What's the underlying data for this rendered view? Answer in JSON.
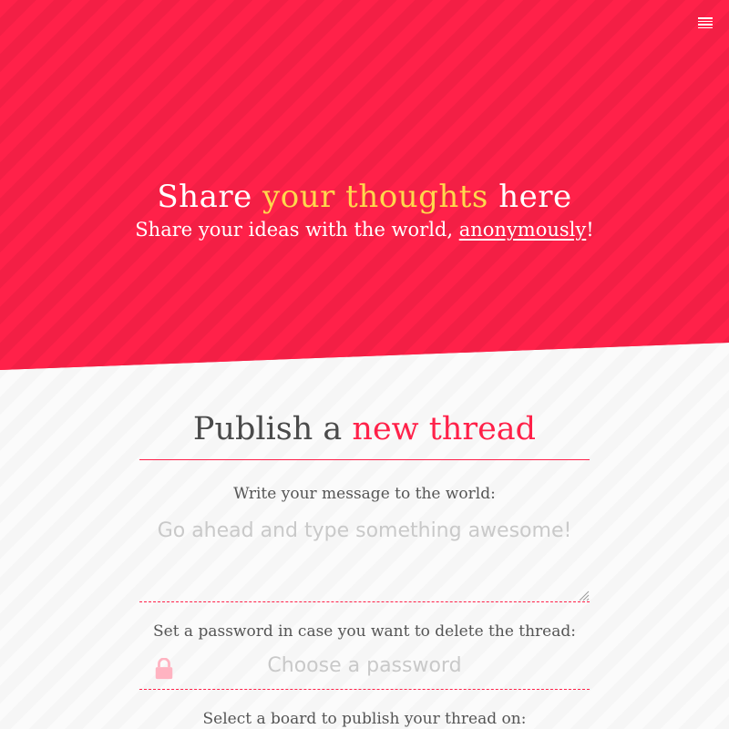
{
  "hero": {
    "title_part1": "Share ",
    "title_accent": "your thoughts",
    "title_part2": " here",
    "subtitle_part1": "Share your ideas with the world, ",
    "subtitle_link": "anonymously",
    "subtitle_part2": "!"
  },
  "menu": {
    "icon": "hamburger-menu-icon"
  },
  "form": {
    "title_part1": "Publish a ",
    "title_accent": "new thread",
    "message_label": "Write your message to the world:",
    "message_placeholder": "Go ahead and type something awesome!",
    "password_label": "Set a password in case you want to delete the thread:",
    "password_placeholder": "Choose a password",
    "board_label": "Select a board to publish your thread on:"
  },
  "colors": {
    "accent": "#ff2149",
    "highlight": "#ffd84d",
    "text_dark": "#4a4a4a",
    "placeholder": "#c9c9c9",
    "lock_icon": "#ffb3c1"
  }
}
